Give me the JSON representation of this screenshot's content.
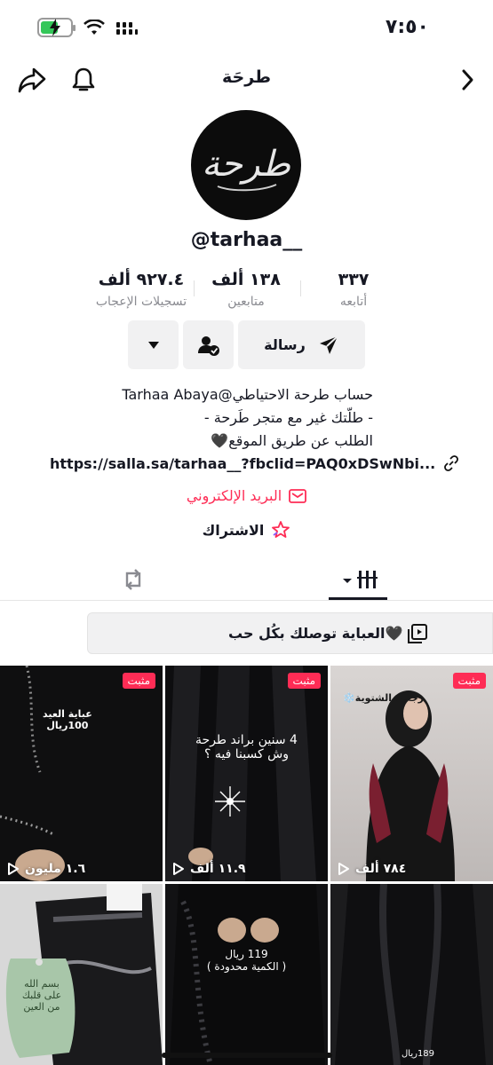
{
  "status_bar": {
    "time": "٧:٥٠",
    "battery_level": 0.6,
    "battery_color": "#34c759"
  },
  "header": {
    "title": "طرحَة",
    "icons": [
      "chevron-right-icon",
      "bell-icon",
      "share-icon"
    ]
  },
  "profile": {
    "avatar_logo": "طرحة",
    "username": "@tarhaa__",
    "stats": {
      "following": {
        "value": "٣٣٧",
        "label": "أتابعه"
      },
      "followers": {
        "value": "١٣٨ ألف",
        "label": "متابعين"
      },
      "likes": {
        "value": "٩٢٧.٤ ألف",
        "label": "تسجيلات الإعجاب"
      }
    },
    "message_label": "رسالة",
    "bio_lines": [
      "حساب طرحة الاحتياطي@Tarhaa Abaya",
      "- طلّتك غير مع متجر طَرحة -",
      "الطلب عن طريق الموقع🖤"
    ],
    "link": "https://salla.sa/tarhaa__?fbclid=PAQ0xDSwNbi...",
    "email_label": "البريد الإلكتروني",
    "subscribe_label": "الاشتراك"
  },
  "playlist_label": "العباية توصلك بكُل حب🖤",
  "videos": [
    {
      "pinned": "مثبت",
      "views": "٧٨٤ ألف",
      "overlay": "رجعت الشتوية❄️"
    },
    {
      "pinned": "مثبت",
      "views": "١١.٩ ألف",
      "overlay": "4 سنين براند طرحة\nوش كسبنا فيه ؟"
    },
    {
      "pinned": "مثبت",
      "views": "١.٦ مليون",
      "overlay": "عباية العيد\n100ريال"
    },
    {
      "views": "",
      "overlay": "189ريال"
    },
    {
      "views": "",
      "overlay": "119 ريال\n( الكمية محدودة )"
    },
    {
      "views": "",
      "overlay": "بسم الله\nعلى قلبك\nمن العين"
    }
  ],
  "colors": {
    "accent": "#fe2c55",
    "text": "#161823",
    "secondary": "#8a8b91",
    "button_bg": "#f1f1f2"
  }
}
